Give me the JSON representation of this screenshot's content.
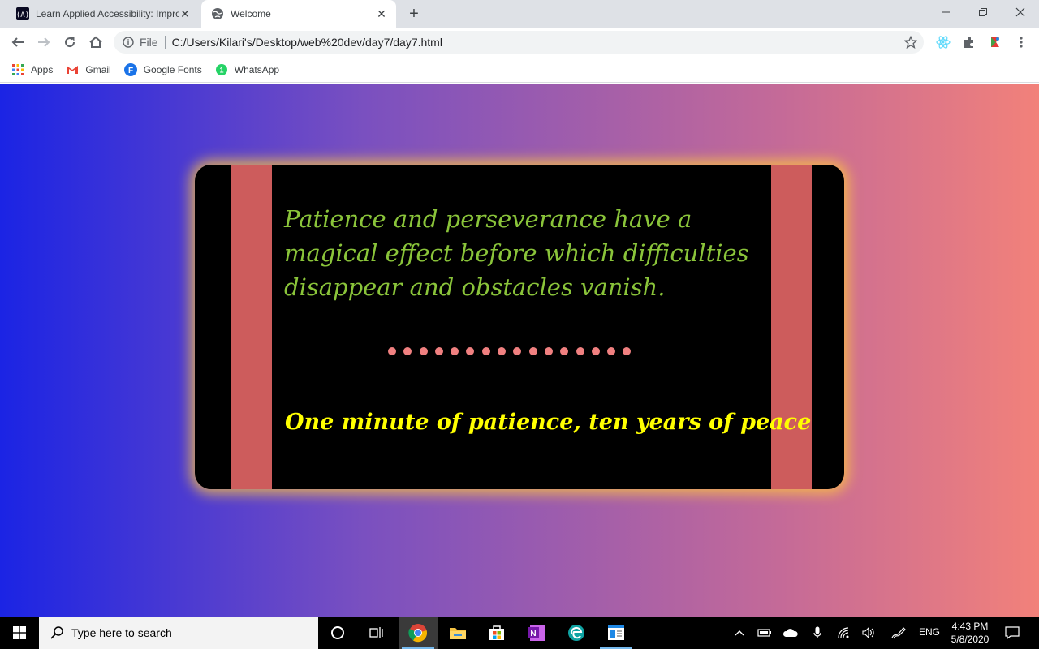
{
  "browser": {
    "tabs": [
      {
        "title": "Learn Applied Accessibility: Impro",
        "active": false
      },
      {
        "title": "Welcome",
        "active": true
      }
    ],
    "omnibox": {
      "scheme_label": "File",
      "url": "C:/Users/Kilari's/Desktop/web%20dev/day7/day7.html"
    },
    "bookmarks": [
      {
        "label": "Apps",
        "icon": "apps-grid-icon"
      },
      {
        "label": "Gmail",
        "icon": "gmail-icon"
      },
      {
        "label": "Google Fonts",
        "icon": "google-fonts-icon"
      },
      {
        "label": "WhatsApp",
        "icon": "whatsapp-icon"
      }
    ]
  },
  "page": {
    "quote_main": "Patience and perseverance have a magical effect before which difficulties disappear and obstacles vanish.",
    "quote_sub": "One minute of patience, ten years of peace",
    "dot_count": 16,
    "colors": {
      "gradient_start": "#1b24e4",
      "gradient_end": "#f2817a",
      "card": "#000000",
      "stripe": "#cd5c5c",
      "quote_main": "#8ac43a",
      "quote_sub": "#ffff00",
      "dots": "#f08080",
      "glow": "#ffc83c"
    }
  },
  "taskbar": {
    "search_placeholder": "Type here to search",
    "language": "ENG",
    "time": "4:43 PM",
    "date": "5/8/2020"
  }
}
